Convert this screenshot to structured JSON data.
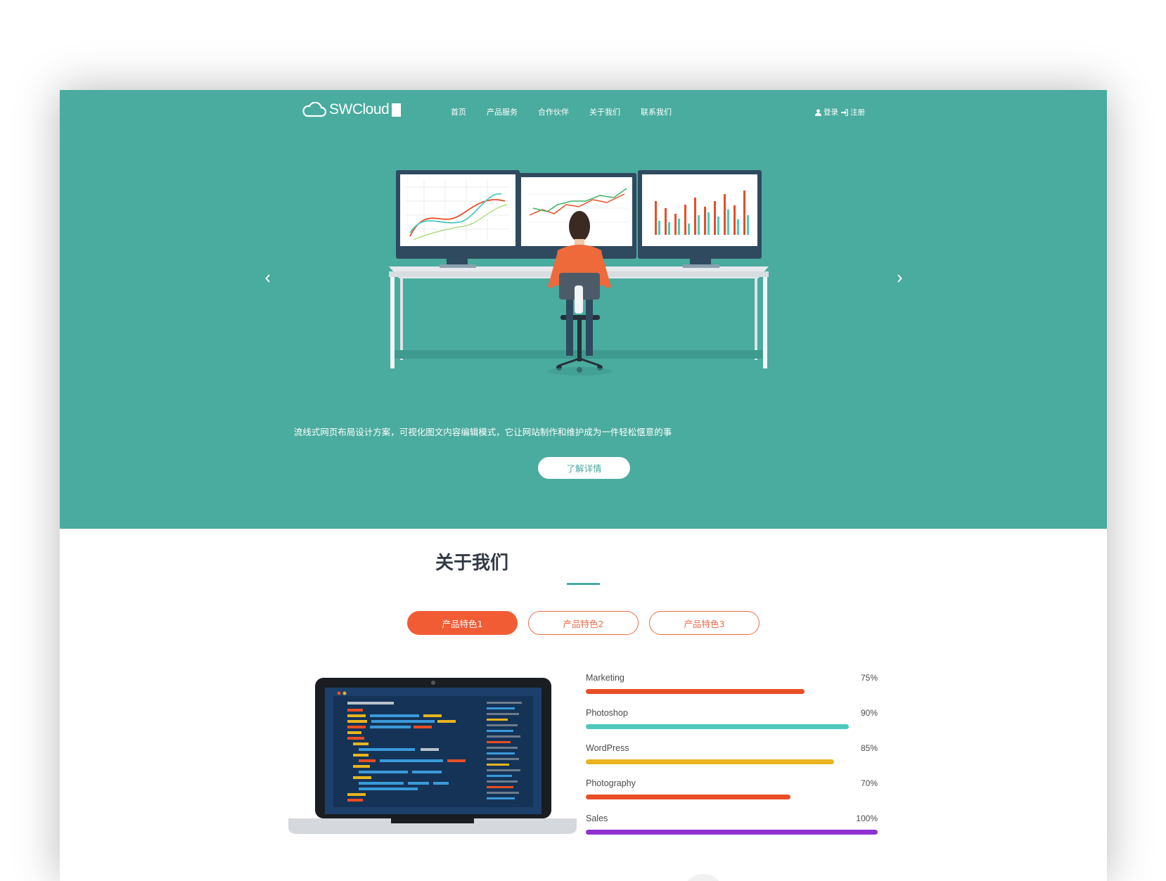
{
  "brand": {
    "name": "SWCloud"
  },
  "nav": {
    "items": [
      {
        "label": "首页"
      },
      {
        "label": "产品服务"
      },
      {
        "label": "合作伙伴"
      },
      {
        "label": "关于我们"
      },
      {
        "label": "联系我们"
      }
    ],
    "login": "登录",
    "register": "注册"
  },
  "hero": {
    "description": "流线式网页布局设计方案，可视化图文内容编辑模式，它让网站制作和维护成为一件轻松惬意的事",
    "button": "了解详情",
    "prev_icon": "chevron-left-icon",
    "next_icon": "chevron-right-icon"
  },
  "about": {
    "title": "关于我们",
    "tabs": [
      {
        "label": "产品特色1",
        "active": true
      },
      {
        "label": "产品特色2",
        "active": false
      },
      {
        "label": "产品特色3",
        "active": false
      }
    ],
    "skills": [
      {
        "name": "Marketing",
        "pct_label": "75%",
        "fraction": 0.75,
        "color": "#e84e24"
      },
      {
        "name": "Photoshop",
        "pct_label": "90%",
        "fraction": 0.9,
        "color": "#4fc9bd"
      },
      {
        "name": "WordPress",
        "pct_label": "85%",
        "fraction": 0.85,
        "color": "#e8b41f"
      },
      {
        "name": "Photography",
        "pct_label": "70%",
        "fraction": 0.7,
        "color": "#e84e24"
      },
      {
        "name": "Sales",
        "pct_label": "100%",
        "fraction": 1.0,
        "color": "#8e32d0"
      }
    ]
  },
  "colors": {
    "hero_bg": "#4aab9f",
    "accent": "#f25c35"
  }
}
